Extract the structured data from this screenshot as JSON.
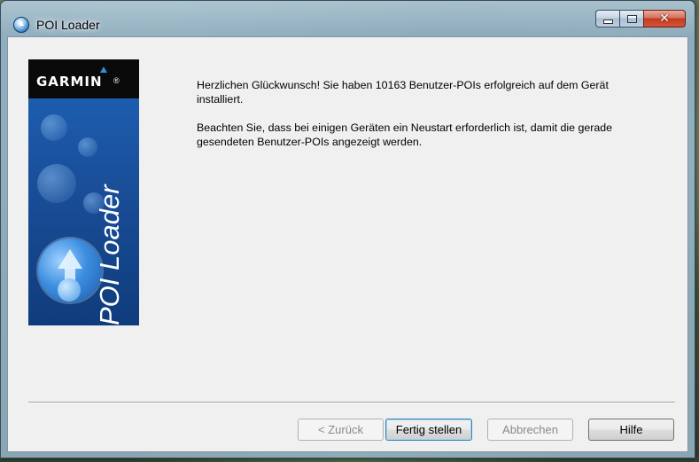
{
  "window": {
    "title": "POI Loader"
  },
  "banner": {
    "brand": "GARMIN",
    "registered_mark": "®",
    "product": "POI Loader"
  },
  "message": {
    "line1": "Herzlichen Glückwunsch! Sie haben 10163 Benutzer-POIs erfolgreich auf dem Gerät installiert.",
    "line2": "Beachten Sie, dass bei einigen Geräten ein Neustart erforderlich ist, damit die gerade gesendeten Benutzer-POIs angezeigt werden."
  },
  "buttons": {
    "back": "< Zurück",
    "finish": "Fertig stellen",
    "cancel": "Abbrechen",
    "help": "Hilfe"
  },
  "caption_buttons": {
    "close_glyph": "✕"
  },
  "icons": {
    "app": "poi-loader-globe-icon",
    "minimize": "minimize-icon",
    "maximize": "maximize-icon",
    "close": "close-icon"
  },
  "colors": {
    "banner_blue": "#1a4f9a",
    "close_red": "#c23b1f",
    "dialog_bg": "#f0f0f0"
  }
}
